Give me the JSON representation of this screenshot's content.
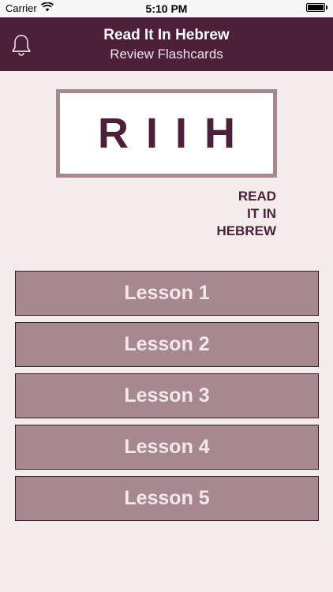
{
  "status_bar": {
    "carrier": "Carrier",
    "time": "5:10 PM",
    "battery_percent": 100
  },
  "nav": {
    "title": "Read It In Hebrew",
    "subtitle": "Review Flashcards",
    "left_icon": "bell-icon"
  },
  "logo": {
    "letters": "RIIH",
    "words": [
      "READ",
      "IT IN",
      "HEBREW"
    ]
  },
  "lessons": [
    {
      "label": "Lesson 1"
    },
    {
      "label": "Lesson 2"
    },
    {
      "label": "Lesson 3"
    },
    {
      "label": "Lesson 4"
    },
    {
      "label": "Lesson 5"
    }
  ],
  "colors": {
    "primary": "#4b2038",
    "button_bg": "#a6888e",
    "background": "#f4eceb"
  }
}
